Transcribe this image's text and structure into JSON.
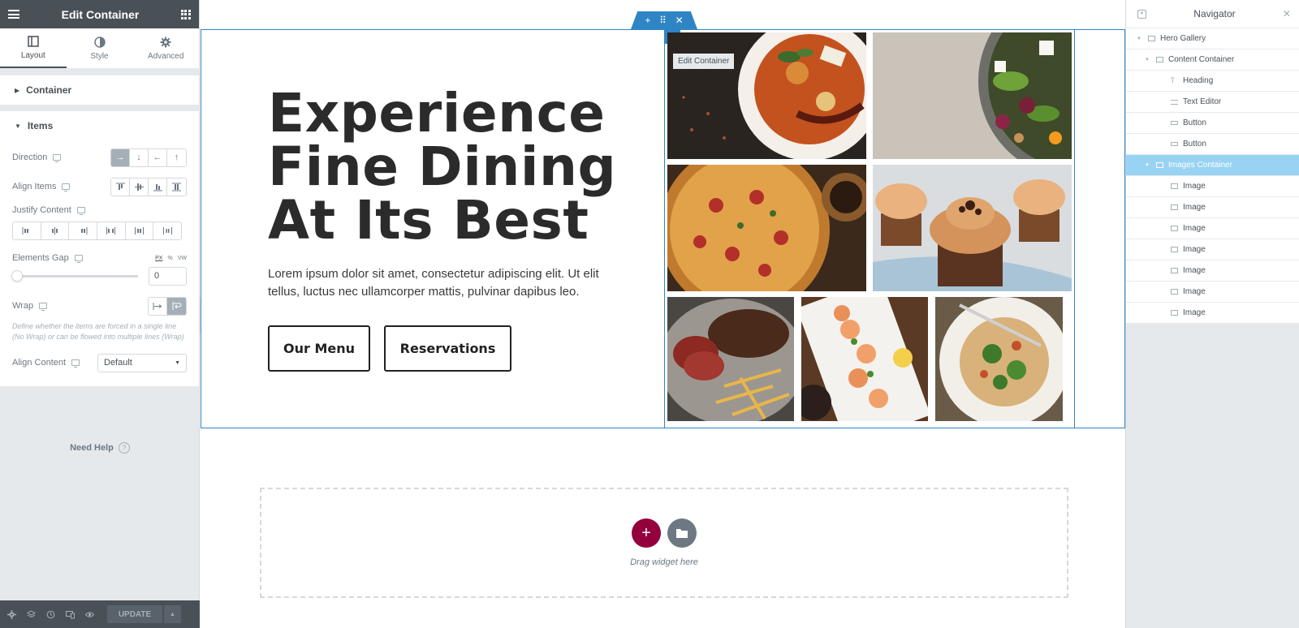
{
  "left_panel": {
    "title": "Edit Container",
    "tabs": [
      {
        "label": "Layout",
        "icon": "layout-icon",
        "active": true
      },
      {
        "label": "Style",
        "icon": "style-icon",
        "active": false
      },
      {
        "label": "Advanced",
        "icon": "gear-icon",
        "active": false
      }
    ],
    "sections": {
      "container": "Container",
      "items": "Items"
    },
    "controls": {
      "direction": {
        "label": "Direction",
        "options": [
          "→",
          "↓",
          "←",
          "↑"
        ],
        "selected": "→"
      },
      "align_items": {
        "label": "Align Items"
      },
      "justify_content": {
        "label": "Justify Content"
      },
      "elements_gap": {
        "label": "Elements Gap",
        "units": [
          "PX",
          "%",
          "VW"
        ],
        "value": "0"
      },
      "wrap": {
        "label": "Wrap",
        "description": "Define whether the items are forced in a single line (No Wrap) or can be flowed into multiple lines (Wrap)"
      },
      "align_content": {
        "label": "Align Content",
        "value": "Default"
      }
    },
    "need_help": "Need Help",
    "footer": {
      "update_label": "UPDATE"
    }
  },
  "canvas": {
    "heading": "Experience Fine Dining At Its Best",
    "text": "Lorem ipsum dolor sit amet, consectetur adipiscing elit. Ut elit tellus, luctus nec ullamcorper mattis, pulvinar dapibus leo.",
    "buttons": {
      "menu": "Our Menu",
      "reservations": "Reservations"
    },
    "edit_tooltip": "Edit Container",
    "drop_zone_text": "Drag widget here"
  },
  "navigator": {
    "title": "Navigator",
    "items": [
      {
        "label": "Hero Gallery",
        "icon": "container-icon"
      },
      {
        "label": "Content Container",
        "icon": "container-icon"
      },
      {
        "label": "Heading",
        "icon": "heading-icon"
      },
      {
        "label": "Text Editor",
        "icon": "text-editor-icon"
      },
      {
        "label": "Button",
        "icon": "button-icon"
      },
      {
        "label": "Button",
        "icon": "button-icon"
      },
      {
        "label": "Images Container",
        "icon": "container-icon",
        "selected": true
      },
      {
        "label": "Image",
        "icon": "image-icon"
      },
      {
        "label": "Image",
        "icon": "image-icon"
      },
      {
        "label": "Image",
        "icon": "image-icon"
      },
      {
        "label": "Image",
        "icon": "image-icon"
      },
      {
        "label": "Image",
        "icon": "image-icon"
      },
      {
        "label": "Image",
        "icon": "image-icon"
      },
      {
        "label": "Image",
        "icon": "image-icon"
      }
    ]
  },
  "colors": {
    "accent": "#2f85c4",
    "panel_dark": "#495157",
    "add_button": "#93003c",
    "nav_selected": "#99d3f3"
  }
}
